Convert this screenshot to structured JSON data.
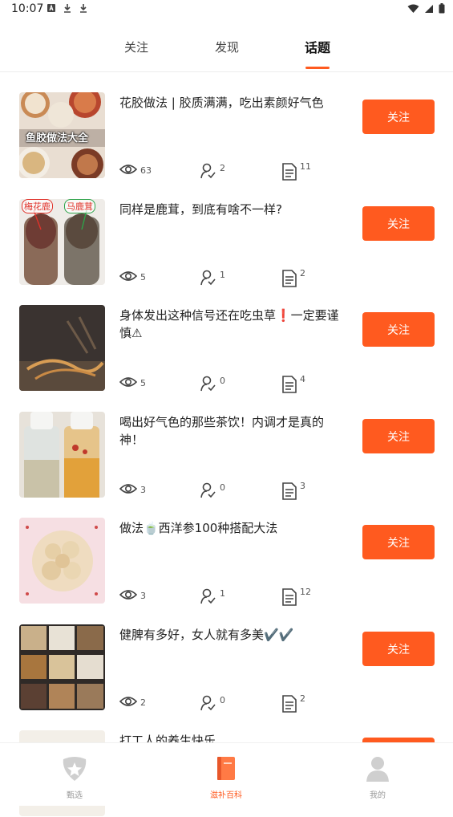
{
  "status_bar": {
    "time": "10:07"
  },
  "tabs": [
    {
      "label": "关注"
    },
    {
      "label": "发现"
    },
    {
      "label": "话题",
      "active": true
    }
  ],
  "topics": [
    {
      "title": "花胶做法 | 胶质满满，吃出素颜好气色",
      "thumb_caption": "鱼胶做法大全",
      "views": "63",
      "followers": "2",
      "posts": "11",
      "button": "关注"
    },
    {
      "title": "同样是鹿茸，到底有啥不一样?",
      "thumb_caption_left": "梅花鹿",
      "thumb_caption_right": "马鹿茸",
      "views": "5",
      "followers": "1",
      "posts": "2",
      "button": "关注"
    },
    {
      "title": "身体发出这种信号还在吃虫草❗一定要谨慎⚠",
      "views": "5",
      "followers": "0",
      "posts": "4",
      "button": "关注"
    },
    {
      "title": "喝出好气色的那些茶饮！内调才是真的神！",
      "views": "3",
      "followers": "0",
      "posts": "3",
      "button": "关注"
    },
    {
      "title": "做法🍵西洋参100种搭配大法",
      "views": "3",
      "followers": "1",
      "posts": "12",
      "button": "关注"
    },
    {
      "title": "健脾有多好，女人就有多美✔️✔️",
      "views": "2",
      "followers": "0",
      "posts": "2",
      "button": "关注"
    },
    {
      "title": "打工人的养生快乐",
      "button": "关注"
    }
  ],
  "bottom_nav": [
    {
      "label": "甄选",
      "icon": "star-badge-icon"
    },
    {
      "label": "滋补百科",
      "icon": "book-icon",
      "active": true
    },
    {
      "label": "我的",
      "icon": "user-icon"
    }
  ],
  "colors": {
    "accent": "#ff5a1f"
  }
}
